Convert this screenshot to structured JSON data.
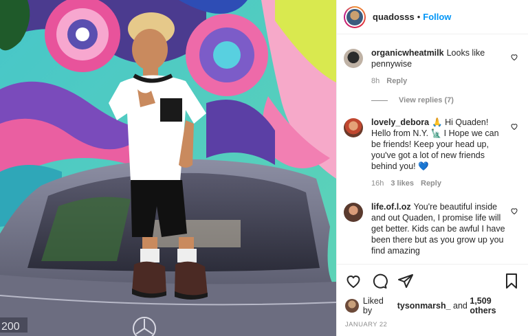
{
  "header": {
    "username": "quadosss",
    "separator": "•",
    "follow_label": "Follow"
  },
  "comments": [
    {
      "user": "organicwheatmilk",
      "text": "Looks like pennywise",
      "time": "8h",
      "likes": "",
      "reply_label": "Reply",
      "view_replies": "View replies (7)"
    },
    {
      "user": "lovely_debora",
      "text": "🙏 Hi Quaden! Hello from N.Y. 🗽 I Hope we can be friends! Keep your head up, you've got a lot of new friends behind you!",
      "heart": "💙",
      "time": "16h",
      "likes": "3 likes",
      "reply_label": "Reply"
    },
    {
      "user": "life.of.l.oz",
      "text": "You're beautiful inside and out Quaden, I promise life will get better. Kids can be awful I have been there but as you grow up you find amazing",
      "time": "",
      "likes": "",
      "reply_label": ""
    }
  ],
  "likes": {
    "prefix": "Liked by",
    "user": "tysonmarsh_",
    "middle": "and",
    "count": "1,509 others"
  },
  "date": "JANUARY 22",
  "photo": {
    "plate_text": "200"
  },
  "icons": [
    "heart-icon",
    "comment-icon",
    "share-icon",
    "bookmark-icon"
  ],
  "colors": {
    "follow": "#0095f6",
    "muted": "#8e8e8e",
    "text": "#262626"
  }
}
